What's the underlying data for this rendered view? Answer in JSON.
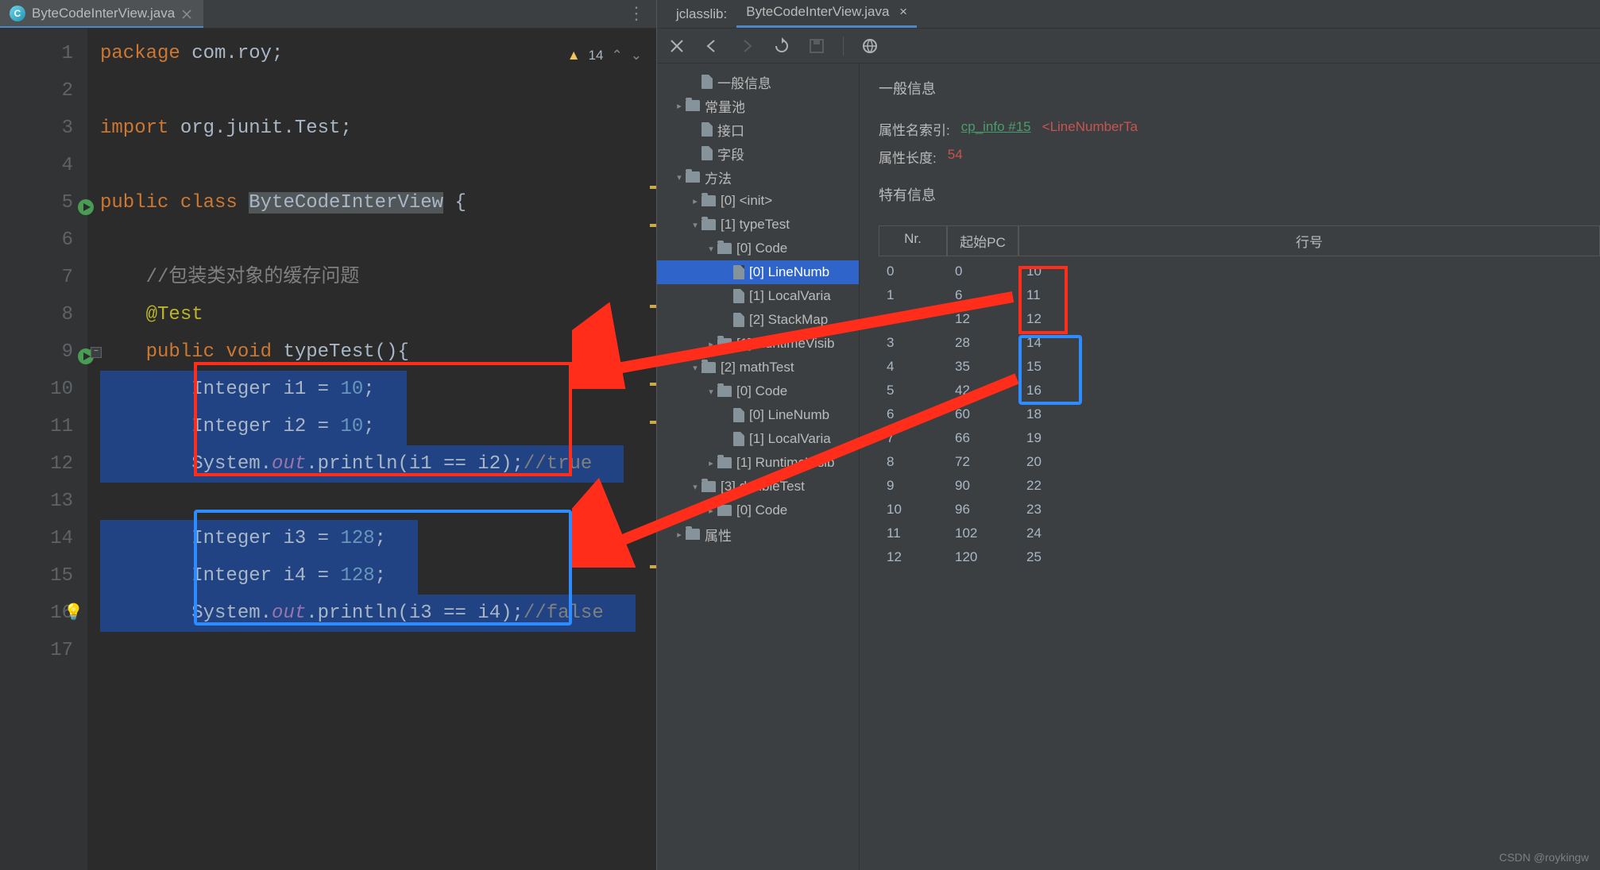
{
  "editor": {
    "tab": {
      "filename": "ByteCodeInterView.java"
    },
    "warnings_count": "14",
    "lines": [
      {
        "n": "1",
        "seg": [
          {
            "t": "package ",
            "c": "kw"
          },
          {
            "t": "com.roy;",
            "c": "ident"
          }
        ]
      },
      {
        "n": "2",
        "seg": []
      },
      {
        "n": "3",
        "seg": [
          {
            "t": "import ",
            "c": "kw"
          },
          {
            "t": "org.junit.Test;",
            "c": "ident"
          }
        ]
      },
      {
        "n": "4",
        "seg": []
      },
      {
        "n": "5",
        "seg": [
          {
            "t": "public class ",
            "c": "kw"
          },
          {
            "t": "ByteCodeInterView",
            "c": "class-name"
          },
          {
            "t": " {",
            "c": "ident"
          }
        ],
        "run": true
      },
      {
        "n": "6",
        "seg": []
      },
      {
        "n": "7",
        "seg": [
          {
            "t": "    //包装类对象的缓存问题",
            "c": "comment"
          }
        ]
      },
      {
        "n": "8",
        "seg": [
          {
            "t": "    ",
            "c": ""
          },
          {
            "t": "@Test",
            "c": "annot"
          }
        ]
      },
      {
        "n": "9",
        "seg": [
          {
            "t": "    ",
            "c": ""
          },
          {
            "t": "public void ",
            "c": "kw"
          },
          {
            "t": "typeTest(){",
            "c": "ident"
          }
        ],
        "run": true,
        "fold": true
      },
      {
        "n": "10",
        "seg": [
          {
            "t": "        Integer i1 = ",
            "c": "ident"
          },
          {
            "t": "10",
            "c": "num"
          },
          {
            "t": ";",
            "c": "ident"
          }
        ],
        "sel": true
      },
      {
        "n": "11",
        "seg": [
          {
            "t": "        Integer i2 = ",
            "c": "ident"
          },
          {
            "t": "10",
            "c": "num"
          },
          {
            "t": ";",
            "c": "ident"
          }
        ],
        "sel": true
      },
      {
        "n": "12",
        "seg": [
          {
            "t": "        System.",
            "c": "ident"
          },
          {
            "t": "out",
            "c": "str-ital"
          },
          {
            "t": ".println(i1 == i2);",
            "c": "ident"
          },
          {
            "t": "//true",
            "c": "comment"
          }
        ],
        "sel": true
      },
      {
        "n": "13",
        "seg": [],
        "sel": true
      },
      {
        "n": "14",
        "seg": [
          {
            "t": "        Integer i3 = ",
            "c": "ident"
          },
          {
            "t": "128",
            "c": "num"
          },
          {
            "t": ";",
            "c": "ident"
          }
        ],
        "sel": true
      },
      {
        "n": "15",
        "seg": [
          {
            "t": "        Integer i4 = ",
            "c": "ident"
          },
          {
            "t": "128",
            "c": "num"
          },
          {
            "t": ";",
            "c": "ident"
          }
        ],
        "sel": true
      },
      {
        "n": "16",
        "seg": [
          {
            "t": "        System.",
            "c": "ident"
          },
          {
            "t": "out",
            "c": "str-ital"
          },
          {
            "t": ".println(i3 == i4);",
            "c": "ident"
          },
          {
            "t": "//false",
            "c": "comment"
          }
        ],
        "sel": true,
        "bulb": true
      },
      {
        "n": "17",
        "seg": []
      }
    ]
  },
  "panel": {
    "tabs": {
      "left": "jclasslib:",
      "right": "ByteCodeInterView.java",
      "close": "×"
    },
    "tree": [
      {
        "depth": 2,
        "icon": "file",
        "label": "一般信息"
      },
      {
        "depth": 1,
        "icon": "folder",
        "arrow": ">",
        "label": "常量池"
      },
      {
        "depth": 2,
        "icon": "file",
        "label": "接口"
      },
      {
        "depth": 2,
        "icon": "file",
        "label": "字段"
      },
      {
        "depth": 1,
        "icon": "folder",
        "arrow": "v",
        "label": "方法"
      },
      {
        "depth": 2,
        "icon": "folder",
        "arrow": ">",
        "label": "[0] <init>"
      },
      {
        "depth": 2,
        "icon": "folder",
        "arrow": "v",
        "label": "[1] typeTest"
      },
      {
        "depth": 3,
        "icon": "folder",
        "arrow": "v",
        "label": "[0] Code"
      },
      {
        "depth": 4,
        "icon": "file",
        "label": "[0] LineNumb",
        "selected": true
      },
      {
        "depth": 4,
        "icon": "file",
        "label": "[1] LocalVaria"
      },
      {
        "depth": 4,
        "icon": "file",
        "label": "[2] StackMap"
      },
      {
        "depth": 3,
        "icon": "folder",
        "arrow": ">",
        "label": "[1] RuntimeVisib"
      },
      {
        "depth": 2,
        "icon": "folder",
        "arrow": "v",
        "label": "[2] mathTest"
      },
      {
        "depth": 3,
        "icon": "folder",
        "arrow": "v",
        "label": "[0] Code"
      },
      {
        "depth": 4,
        "icon": "file",
        "label": "[0] LineNumb"
      },
      {
        "depth": 4,
        "icon": "file",
        "label": "[1] LocalVaria"
      },
      {
        "depth": 3,
        "icon": "folder",
        "arrow": ">",
        "label": "[1] RuntimeVisib"
      },
      {
        "depth": 2,
        "icon": "folder",
        "arrow": "v",
        "label": "[3] doubleTest"
      },
      {
        "depth": 3,
        "icon": "folder",
        "arrow": ">",
        "label": "[0] Code"
      },
      {
        "depth": 1,
        "icon": "folder",
        "arrow": ">",
        "label": "属性"
      }
    ],
    "info": {
      "heading1": "一般信息",
      "attr_name_label": "属性名索引:",
      "attr_name_link": "cp_info #15",
      "attr_name_value": "<LineNumberTa",
      "attr_len_label": "属性长度:",
      "attr_len_value": "54",
      "heading2": "特有信息",
      "table_headers": {
        "nr": "Nr.",
        "pc": "起始PC",
        "line": "行号"
      },
      "rows": [
        {
          "nr": "0",
          "pc": "0",
          "line": "10"
        },
        {
          "nr": "1",
          "pc": "6",
          "line": "11"
        },
        {
          "nr": "2",
          "pc": "12",
          "line": "12"
        },
        {
          "nr": "3",
          "pc": "28",
          "line": "14"
        },
        {
          "nr": "4",
          "pc": "35",
          "line": "15"
        },
        {
          "nr": "5",
          "pc": "42",
          "line": "16"
        },
        {
          "nr": "6",
          "pc": "60",
          "line": "18"
        },
        {
          "nr": "7",
          "pc": "66",
          "line": "19"
        },
        {
          "nr": "8",
          "pc": "72",
          "line": "20"
        },
        {
          "nr": "9",
          "pc": "90",
          "line": "22"
        },
        {
          "nr": "10",
          "pc": "96",
          "line": "23"
        },
        {
          "nr": "11",
          "pc": "102",
          "line": "24"
        },
        {
          "nr": "12",
          "pc": "120",
          "line": "25"
        }
      ]
    }
  },
  "watermark": "CSDN @roykingw"
}
